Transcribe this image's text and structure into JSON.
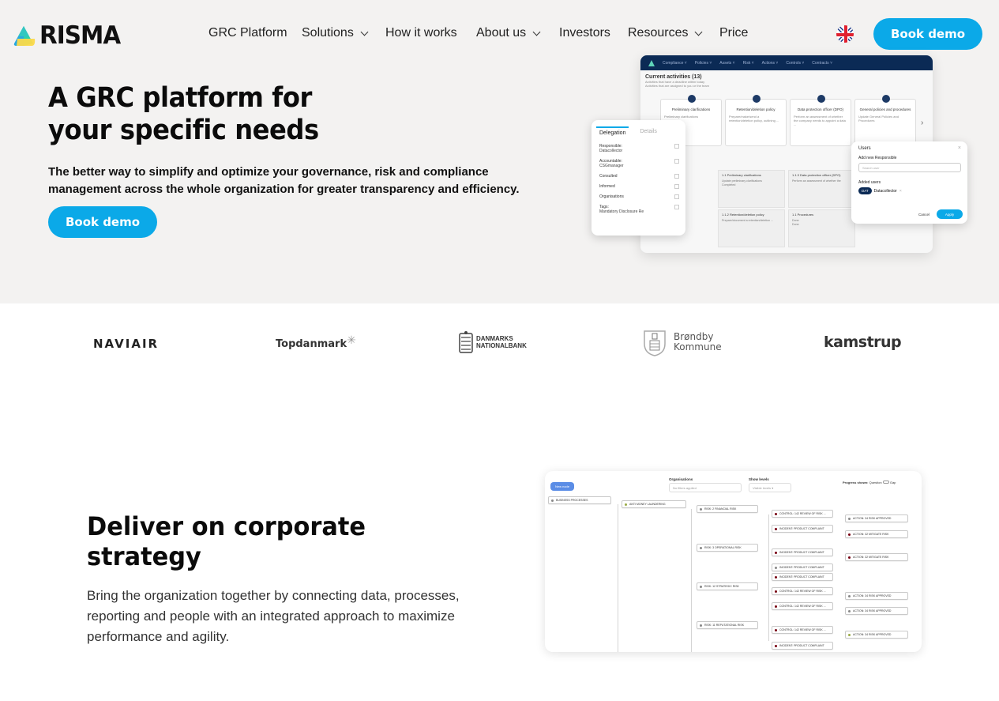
{
  "nav": {
    "brand": "RISMA",
    "items": [
      {
        "label": "GRC Platform",
        "dropdown": false
      },
      {
        "label": "Solutions",
        "dropdown": true
      },
      {
        "label": "How it works",
        "dropdown": false
      },
      {
        "label": "About us",
        "dropdown": true
      },
      {
        "label": "Investors",
        "dropdown": false
      },
      {
        "label": "Resources",
        "dropdown": true
      },
      {
        "label": "Price",
        "dropdown": false
      }
    ],
    "language_icon": "uk-flag-icon",
    "cta_label": "Book demo"
  },
  "hero": {
    "title": "A GRC platform for your specific needs",
    "subtitle": "The better way to simplify and optimize your governance, risk and compliance management across the whole organization for greater transparency and efficiency.",
    "cta_label": "Book demo",
    "mock": {
      "menu": [
        "Compliance ˅",
        "Policies ˅",
        "Assets ˅",
        "Risk ˅",
        "Actions ˅",
        "Controls ˅",
        "Contracts ˅"
      ],
      "section_title": "Current activities (13)",
      "section_sub1": "Activities that have a deadline within today",
      "section_sub2": "Activities that are assigned to you or the team",
      "cards": [
        {
          "title": "Preliminary clarifications",
          "desc": "Preliminary clarifications"
        },
        {
          "title": "Retention/deletion policy",
          "desc": "Prepare/make/send a retention/deletion policy, outlining ..."
        },
        {
          "title": "Data protection officer (DPO)",
          "desc": "Perform an assessment of whether the company needs to appoint a data ..."
        },
        {
          "title": "General policies and procedures",
          "desc": "Update General Policies and Procedures"
        }
      ],
      "tiles": [
        {
          "title": "1.1 Preliminary clarifications",
          "desc": "Update preliminary clarifications",
          "status": "Completed"
        },
        {
          "title": "1.1.3 Data protection officer (DPO)",
          "desc": "Perform an assessment of whether the",
          "status": ""
        },
        {
          "title": "1.1.2 Retention/deletion policy",
          "desc": "Prepare/document a retention/deletion ...",
          "status": ""
        },
        {
          "title": "1.1 Procedures",
          "desc": "Done",
          "status": "Done"
        }
      ],
      "delegation": {
        "tab_active": "Delegation",
        "tab_inactive": "Details",
        "rows": [
          {
            "label": "Responsible:",
            "value": "Datacollector"
          },
          {
            "label": "Accountable:",
            "value": "CSGmanager"
          },
          {
            "label": "Consulted",
            "value": ""
          },
          {
            "label": "Informed",
            "value": ""
          },
          {
            "label": "Organisations",
            "value": ""
          },
          {
            "label": "Tags:",
            "value": "Mandatory Disclosure Re"
          }
        ]
      },
      "users": {
        "title": "Users",
        "add_label": "Add new Responsible",
        "search_placeholder": "Search user",
        "added_label": "Added users",
        "chip": "DAT",
        "user_name": "Datacollector",
        "cancel": "Cancel",
        "apply": "Apply"
      }
    }
  },
  "logos": [
    {
      "name": "NAVIAIR"
    },
    {
      "name": "Topdanmark"
    },
    {
      "name": "DANMARKS NATIONALBANK"
    },
    {
      "name": "Brøndby Kommune"
    },
    {
      "name": "kamstrup"
    }
  ],
  "section2": {
    "title": "Deliver on corporate strategy",
    "subtitle": "Bring the organization together by connecting data, processes, reporting and people with an integrated approach to maximize performance and agility.",
    "tree": {
      "new_node": "New node",
      "org_label": "Organisations",
      "org_placeholder": "No filters applied",
      "levels_label": "Show levels",
      "levels_value": "Visible levels",
      "progress_label": "Progress shown:",
      "progress_left": "Question",
      "progress_right": "Gap",
      "nodes": [
        "BUSINESS PROCESSES",
        "ANTI MONEY LAUNDERING",
        "RISK: 2 FINANCIAL RISK",
        "CONTROL: 142 REVIEW OF RISK ...",
        "INCIDENT: PRODUCT COMPLAINT",
        "ACTION: 34 RISK APPROVED",
        "ACTION: 32 MITIGATE RISK",
        "RISK: 3 OPERATIONAL RISK",
        "INCIDENT: PRODUCT COMPLAINT",
        "ACTION: 32 MITIGATE RISK",
        "INCIDENT: PRODUCT COMPLAINT",
        "INCIDENT: PRODUCT COMPLAINT",
        "RISK: 12 STRATEGIC RISK",
        "CONTROL: 142 REVIEW OF RISK ...",
        "ACTION: 34 RISK APPROVED",
        "CONTROL: 142 REVIEW OF RISK ...",
        "ACTION: 34 RISK APPROVED",
        "RISK: 11 REPUTATIONAL RISK",
        "CONTROL: 142 REVIEW OF RISK ...",
        "ACTION: 34 RISK APPROVED",
        "INCIDENT: PRODUCT COMPLAINT"
      ]
    }
  },
  "colors": {
    "accent": "#0ba9e8",
    "hero_bg": "#f3f2f1",
    "mock_nav": "#0b2a55"
  }
}
